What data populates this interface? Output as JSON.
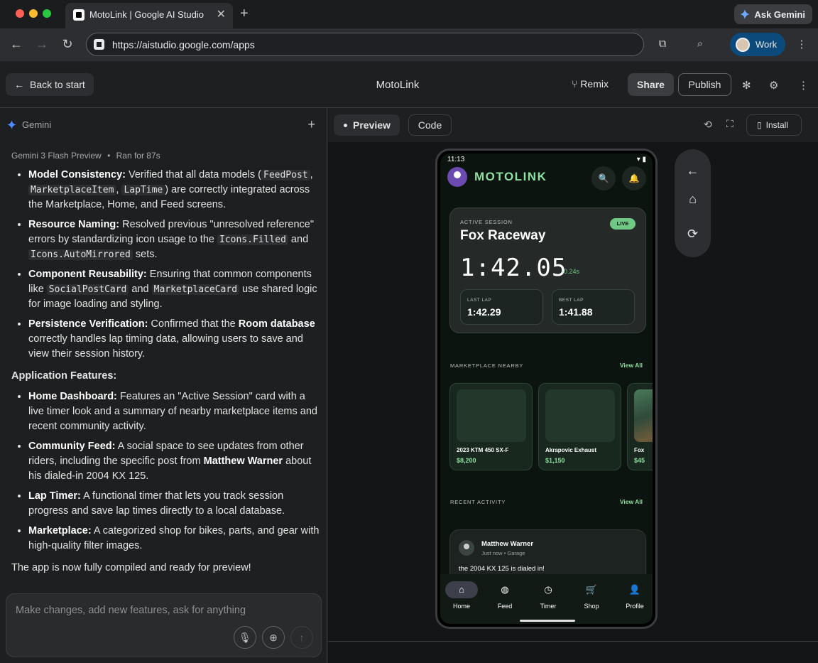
{
  "browser": {
    "tab_title": "MotoLink | Google AI Studio",
    "url": "https://aistudio.google.com/apps",
    "ask_gemini": "Ask Gemini",
    "profile": "Work",
    "colors": {
      "close": "#ff5f57",
      "minimize": "#febc2e",
      "maximize": "#28c840"
    }
  },
  "header": {
    "back_label": "Back to start",
    "title": "MotoLink",
    "remix": "Remix",
    "share": "Share",
    "publish": "Publish"
  },
  "left": {
    "agent": "Gemini",
    "meta_model": "Gemini 3 Flash Preview",
    "meta_time": "Ran for 87s",
    "bullets1": [
      {
        "b": "Model Consistency:",
        "t1": " Verified that all data models (",
        "c1": "FeedPost",
        "t2": ", ",
        "c2": "MarketplaceItem",
        "t3": ", ",
        "c3": "LapTime",
        "t4": ") are correctly integrated across the Marketplace, Home, and Feed screens."
      },
      {
        "b": "Resource Naming:",
        "t1": " Resolved previous \"unresolved reference\" errors by standardizing icon usage to the ",
        "c1": "Icons.Filled",
        "t2": " and ",
        "c2": "Icons.AutoMirrored",
        "t3": " sets."
      },
      {
        "b": "Component Reusability:",
        "t1": " Ensuring that common components like ",
        "c1": "SocialPostCard",
        "t2": " and ",
        "c2": "MarketplaceCard",
        "t3": " use shared logic for image loading and styling."
      },
      {
        "b": "Persistence Verification:",
        "t1": " Confirmed that the ",
        "b2": "Room database",
        "t2": " correctly handles lap timing data, allowing users to save and view their session history."
      }
    ],
    "section": "Application Features:",
    "bullets2": [
      {
        "b": "Home Dashboard:",
        "t": " Features an \"Active Session\" card with a live timer look and a summary of nearby marketplace items and recent community activity."
      },
      {
        "b": "Community Feed:",
        "t": " A social space to see updates from other riders, including the specific post from ",
        "b2": "Matthew Warner",
        "t2": " about his dialed-in 2004 KX 125."
      },
      {
        "b": "Lap Timer:",
        "t": " A functional timer that lets you track session progress and save lap times directly to a local database."
      },
      {
        "b": "Marketplace:",
        "t": " A categorized shop for bikes, parts, and gear with high-quality filter images."
      }
    ],
    "closing": "The app is now fully compiled and ready for preview!",
    "input_placeholder": "Make changes, add new features, ask for anything"
  },
  "right": {
    "preview_tab": "Preview",
    "code_tab": "Code",
    "install": "Install"
  },
  "phone": {
    "time": "11:13",
    "app_title": "MOTOLINK",
    "session": {
      "label": "ACTIVE SESSION",
      "track": "Fox Raceway",
      "live": "LIVE",
      "time": "1:42.05",
      "delta": "-0.24s",
      "last_label": "LAST LAP",
      "last": "1:42.29",
      "best_label": "BEST LAP",
      "best": "1:41.88"
    },
    "market_header": "MARKETPLACE NEARBY",
    "view_all": "View All",
    "items": [
      {
        "name": "2023 KTM 450 SX-F",
        "price": "$8,200"
      },
      {
        "name": "Akrapovic Exhaust",
        "price": "$1,150"
      },
      {
        "name": "Fox",
        "price": "$45"
      }
    ],
    "recent_header": "RECENT ACTIVITY",
    "post": {
      "author": "Matthew Warner",
      "meta": "Just now • Garage",
      "text": "the 2004 KX 125 is dialed in!"
    },
    "nav": [
      {
        "label": "Home",
        "icon": "home-icon"
      },
      {
        "label": "Feed",
        "icon": "globe-icon"
      },
      {
        "label": "Timer",
        "icon": "clock-icon"
      },
      {
        "label": "Shop",
        "icon": "cart-icon"
      },
      {
        "label": "Profile",
        "icon": "person-icon"
      }
    ]
  }
}
